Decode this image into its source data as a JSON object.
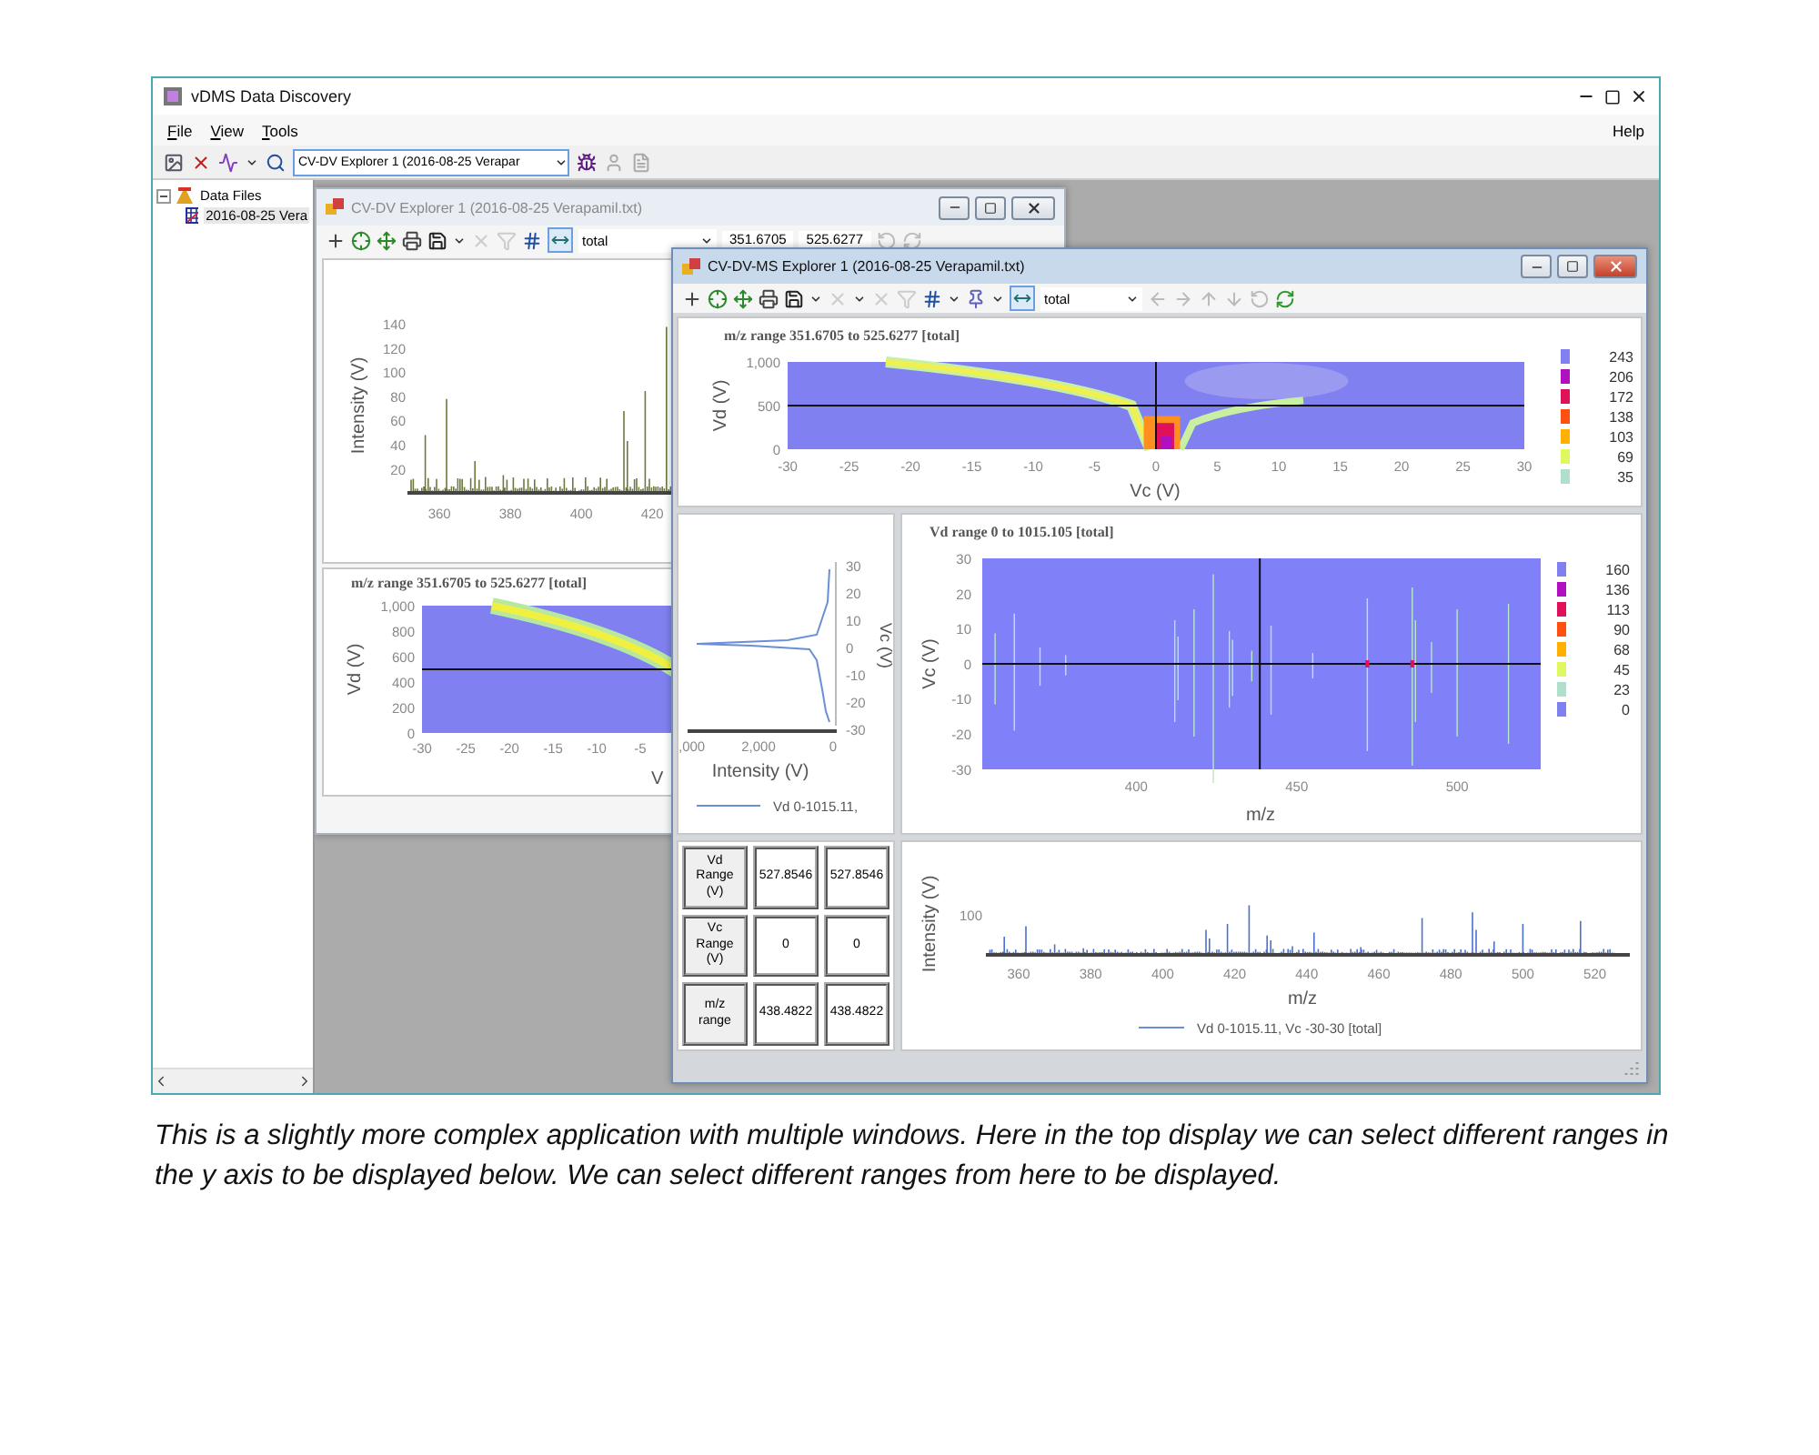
{
  "app": {
    "title": "vDMS Data Discovery",
    "menu": [
      {
        "label": "File"
      },
      {
        "label": "View"
      },
      {
        "label": "Tools"
      }
    ],
    "help": "Help",
    "explorer_select": "CV-DV Explorer 1 (2016-08-25 Verapar"
  },
  "tree": {
    "items": [
      {
        "label": "Data Files",
        "expanded": true,
        "children": [
          {
            "label": "2016-08-25 Vera"
          }
        ]
      }
    ]
  },
  "windows": [
    {
      "title": "CV-DV Explorer 1 (2016-08-25 Verapamil.txt)",
      "active": false,
      "mode": "total",
      "range_from": "351.6705",
      "range_to": "525.6277",
      "spectrum": {
        "ylabel": "Intensity (V)",
        "yticks": [
          "140",
          "120",
          "100",
          "80",
          "60",
          "40",
          "20"
        ],
        "xticks": [
          "360",
          "380",
          "400",
          "420"
        ]
      },
      "heatmap": {
        "title": "m/z range 351.6705 to 525.6277 [total]",
        "ylabel": "Vd (V)",
        "yticks": [
          "1,000",
          "800",
          "600",
          "400",
          "200",
          "0"
        ],
        "xticks": [
          "-30",
          "-25",
          "-20",
          "-15",
          "-10",
          "-5"
        ],
        "xlabel": "V"
      }
    },
    {
      "title": "CV-DV-MS Explorer 1 (2016-08-25 Verapamil.txt)",
      "active": true,
      "mode": "total",
      "top_heatmap": {
        "title": "m/z range 351.6705 to 525.6277 [total]",
        "ylabel": "Vd (V)",
        "yticks": [
          "1,000",
          "500",
          "0"
        ],
        "xticks": [
          "-30",
          "-25",
          "-20",
          "-15",
          "-10",
          "-5",
          "0",
          "5",
          "10",
          "15",
          "20",
          "25",
          "30"
        ],
        "xlabel": "Vc (V)",
        "legend": [
          {
            "label": "243",
            "color": "#8080f0"
          },
          {
            "label": "206",
            "color": "#b010c0"
          },
          {
            "label": "172",
            "color": "#e0105a"
          },
          {
            "label": "138",
            "color": "#ff5010"
          },
          {
            "label": "103",
            "color": "#ffb000"
          },
          {
            "label": "69",
            "color": "#e0f860"
          },
          {
            "label": "35",
            "color": "#b0e0cc"
          }
        ]
      },
      "profile": {
        "yticks": [
          "30",
          "20",
          "10",
          "0",
          "-10",
          "-20",
          "-30"
        ],
        "ylabel": "Vc (V)",
        "xticks": [
          ",000",
          "2,000",
          "0"
        ],
        "xlabel": "Intensity (V)",
        "legend": "Vd 0-1015.11,"
      },
      "mid_heatmap": {
        "title": "Vd range 0 to 1015.105 [total]",
        "ylabel": "Vc (V)",
        "yticks": [
          "30",
          "20",
          "10",
          "0",
          "-10",
          "-20",
          "-30"
        ],
        "xticks": [
          "400",
          "450",
          "500"
        ],
        "xlabel": "m/z",
        "legend": [
          {
            "label": "160",
            "color": "#8080f0"
          },
          {
            "label": "136",
            "color": "#b010c0"
          },
          {
            "label": "113",
            "color": "#e0105a"
          },
          {
            "label": "90",
            "color": "#ff5010"
          },
          {
            "label": "68",
            "color": "#ffb000"
          },
          {
            "label": "45",
            "color": "#e0f860"
          },
          {
            "label": "23",
            "color": "#b0e0cc"
          },
          {
            "label": "0",
            "color": "#8081f0"
          }
        ]
      },
      "table": {
        "rows": [
          {
            "header": "Vd Range (V)",
            "values": [
              "527.8546",
              "527.8546"
            ]
          },
          {
            "header": "Vc Range (V)",
            "values": [
              "0",
              "0"
            ]
          },
          {
            "header": "m/z range",
            "values": [
              "438.4822",
              "438.4822"
            ]
          }
        ]
      },
      "spectrum": {
        "ylabel": "Intensity (V)",
        "yticks": [
          "100"
        ],
        "xticks": [
          "360",
          "380",
          "400",
          "420",
          "440",
          "460",
          "480",
          "500",
          "520"
        ],
        "xlabel": "m/z",
        "legend": "Vd 0-1015.11, Vc -30-30 [total]"
      }
    }
  ],
  "caption": "This is a slightly more complex application with multiple windows. Here in the top display we can select different ranges in the y axis to be displayed below.  We can select different ranges from here to be displayed."
}
